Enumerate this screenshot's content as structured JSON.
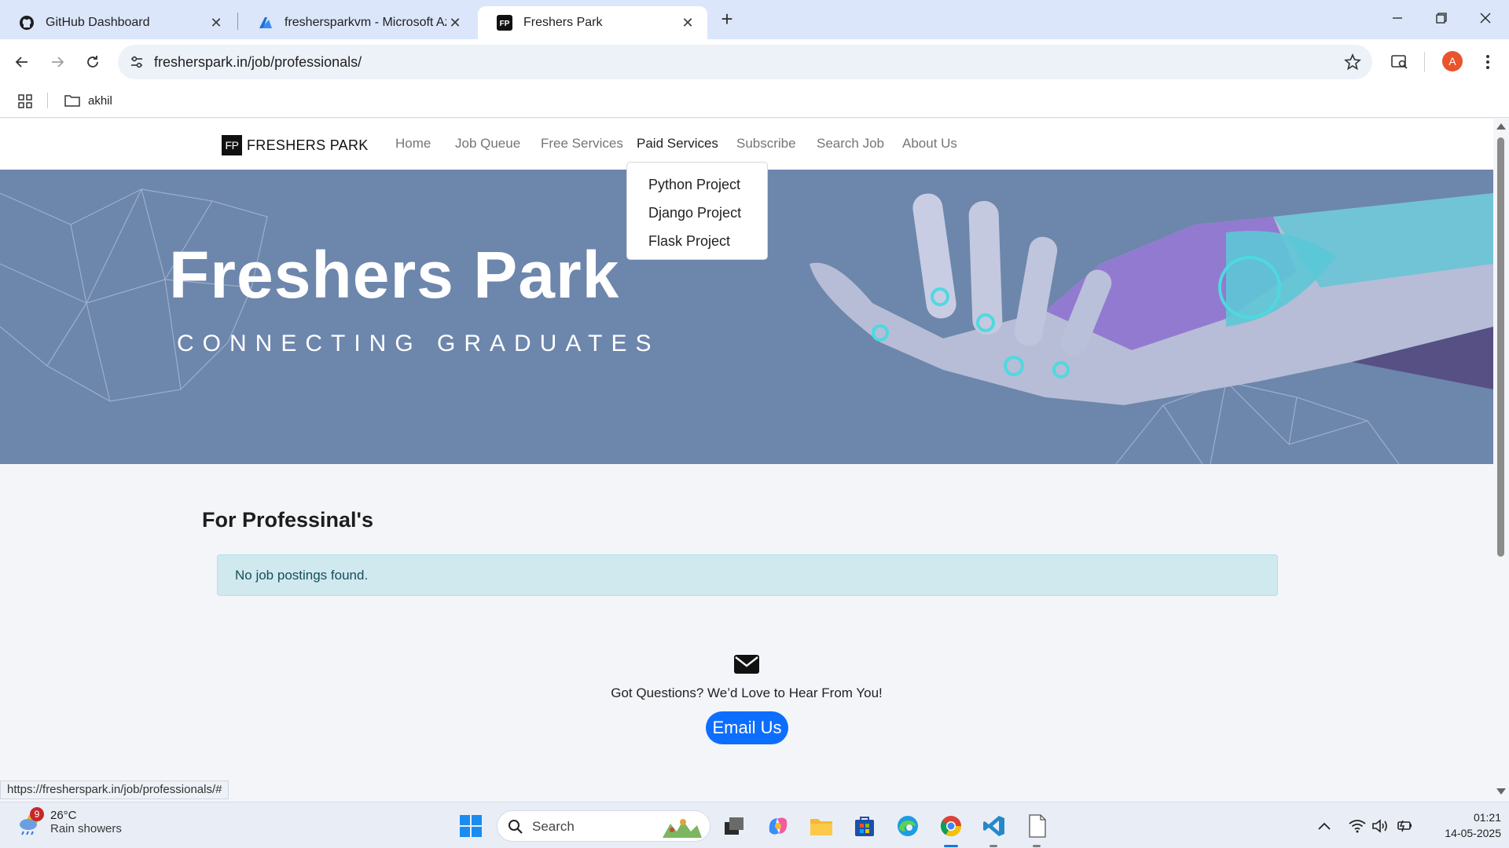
{
  "browser": {
    "tabs": [
      {
        "title": "GitHub Dashboard",
        "icon": "github-icon",
        "active": false
      },
      {
        "title": "freshersparkvm - Microsoft Azu",
        "icon": "azure-icon",
        "active": false
      },
      {
        "title": "Freshers Park",
        "icon": "fp-icon",
        "active": true
      }
    ],
    "url": "fresherspark.in/job/professionals/",
    "bookmarks": [
      {
        "label": "akhil",
        "icon": "folder-icon"
      }
    ],
    "profile_initial": "A",
    "status_url": "https://fresherspark.in/job/professionals/#"
  },
  "site": {
    "logo_mark": "FP",
    "brand": "FRESHERS PARK",
    "nav": [
      {
        "label": "Home"
      },
      {
        "label": "Job Queue"
      },
      {
        "label": "Free Services"
      },
      {
        "label": "Paid Services",
        "active": true
      },
      {
        "label": "Subscribe"
      },
      {
        "label": "Search Job"
      },
      {
        "label": "About Us"
      }
    ],
    "dropdown": [
      "Python Project",
      "Django Project",
      "Flask Project"
    ],
    "hero": {
      "title": "Freshers Park",
      "subtitle": "CONNECTING GRADUATES"
    },
    "section_title": "For Professinal's",
    "alert": "No job postings found.",
    "contact": {
      "text": "Got Questions? We’d Love to Hear From You!",
      "button": "Email Us"
    }
  },
  "taskbar": {
    "weather": {
      "temp": "26°C",
      "desc": "Rain showers",
      "badge": "9"
    },
    "search_placeholder": "Search",
    "time": "01:21",
    "date": "14-05-2025"
  },
  "colors": {
    "tabstrip": "#dbe6fa",
    "hero_bg": "#6d86ac",
    "alert_bg": "#d0e9ee",
    "primary_button": "#0d6efd"
  }
}
